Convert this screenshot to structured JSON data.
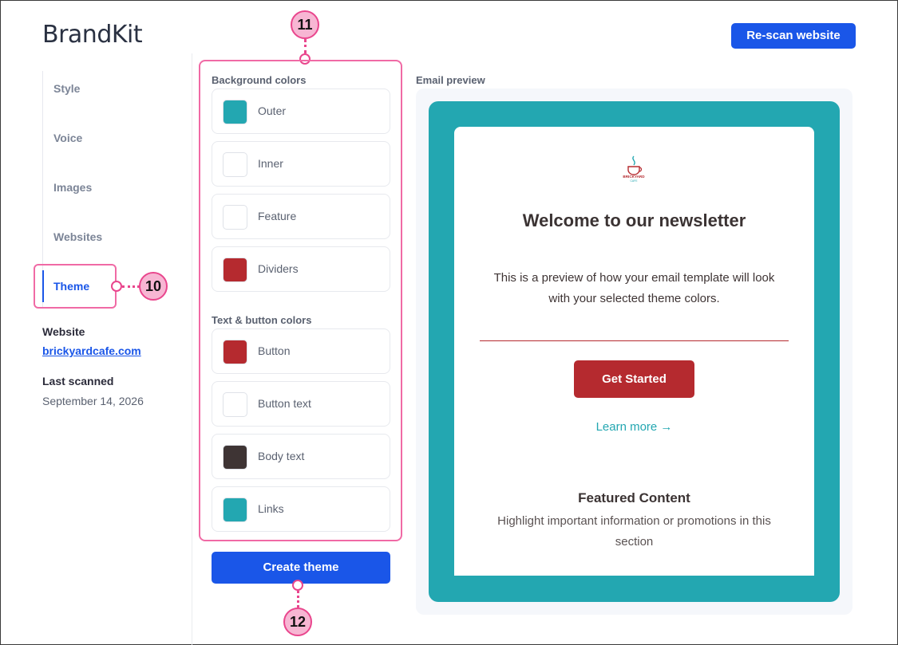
{
  "header": {
    "title": "BrandKit",
    "rescan_label": "Re-scan website"
  },
  "sidebar": {
    "items": [
      {
        "label": "Style"
      },
      {
        "label": "Voice"
      },
      {
        "label": "Images"
      },
      {
        "label": "Websites"
      },
      {
        "label": "Theme",
        "active": true
      }
    ],
    "website_label": "Website",
    "website_link": "brickyardcafe.com",
    "last_scanned_label": "Last scanned",
    "last_scanned_value": "September 14, 2026"
  },
  "callouts": {
    "nav": "10",
    "panel": "11",
    "create": "12"
  },
  "colors_panel": {
    "background_title": "Background colors",
    "background": [
      {
        "label": "Outer",
        "color": "#23a7b1"
      },
      {
        "label": "Inner",
        "color": "#ffffff"
      },
      {
        "label": "Feature",
        "color": "#ffffff"
      },
      {
        "label": "Dividers",
        "color": "#b52a2f"
      }
    ],
    "text_title": "Text & button colors",
    "text": [
      {
        "label": "Button",
        "color": "#b52a2f"
      },
      {
        "label": "Button text",
        "color": "#ffffff"
      },
      {
        "label": "Body text",
        "color": "#3e3434"
      },
      {
        "label": "Links",
        "color": "#23a7b1"
      }
    ],
    "create_label": "Create theme"
  },
  "preview": {
    "label": "Email preview",
    "title": "Welcome to our newsletter",
    "body": "This is a preview of how your email template will look with your selected theme colors.",
    "button_label": "Get Started",
    "link_label": "Learn more →",
    "feature_title": "Featured Content",
    "feature_body": "Highlight important information or promotions in this section",
    "logo_text": "BRICKYARD",
    "logo_subtext": "CAFE"
  },
  "accent": "#1a56e8"
}
